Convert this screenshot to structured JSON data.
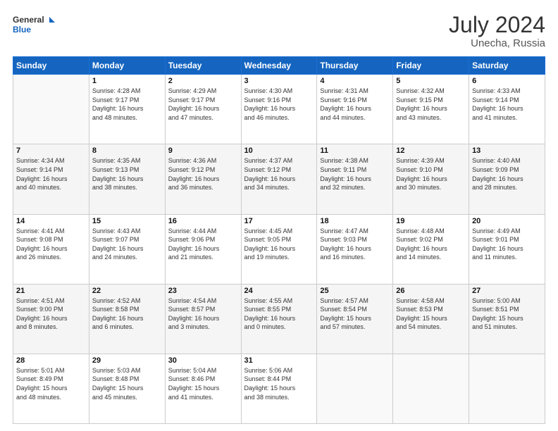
{
  "header": {
    "logo_line1": "General",
    "logo_line2": "Blue",
    "month_year": "July 2024",
    "location": "Unecha, Russia"
  },
  "weekdays": [
    "Sunday",
    "Monday",
    "Tuesday",
    "Wednesday",
    "Thursday",
    "Friday",
    "Saturday"
  ],
  "weeks": [
    [
      {
        "day": "",
        "info": ""
      },
      {
        "day": "1",
        "info": "Sunrise: 4:28 AM\nSunset: 9:17 PM\nDaylight: 16 hours\nand 48 minutes."
      },
      {
        "day": "2",
        "info": "Sunrise: 4:29 AM\nSunset: 9:17 PM\nDaylight: 16 hours\nand 47 minutes."
      },
      {
        "day": "3",
        "info": "Sunrise: 4:30 AM\nSunset: 9:16 PM\nDaylight: 16 hours\nand 46 minutes."
      },
      {
        "day": "4",
        "info": "Sunrise: 4:31 AM\nSunset: 9:16 PM\nDaylight: 16 hours\nand 44 minutes."
      },
      {
        "day": "5",
        "info": "Sunrise: 4:32 AM\nSunset: 9:15 PM\nDaylight: 16 hours\nand 43 minutes."
      },
      {
        "day": "6",
        "info": "Sunrise: 4:33 AM\nSunset: 9:14 PM\nDaylight: 16 hours\nand 41 minutes."
      }
    ],
    [
      {
        "day": "7",
        "info": "Sunrise: 4:34 AM\nSunset: 9:14 PM\nDaylight: 16 hours\nand 40 minutes."
      },
      {
        "day": "8",
        "info": "Sunrise: 4:35 AM\nSunset: 9:13 PM\nDaylight: 16 hours\nand 38 minutes."
      },
      {
        "day": "9",
        "info": "Sunrise: 4:36 AM\nSunset: 9:12 PM\nDaylight: 16 hours\nand 36 minutes."
      },
      {
        "day": "10",
        "info": "Sunrise: 4:37 AM\nSunset: 9:12 PM\nDaylight: 16 hours\nand 34 minutes."
      },
      {
        "day": "11",
        "info": "Sunrise: 4:38 AM\nSunset: 9:11 PM\nDaylight: 16 hours\nand 32 minutes."
      },
      {
        "day": "12",
        "info": "Sunrise: 4:39 AM\nSunset: 9:10 PM\nDaylight: 16 hours\nand 30 minutes."
      },
      {
        "day": "13",
        "info": "Sunrise: 4:40 AM\nSunset: 9:09 PM\nDaylight: 16 hours\nand 28 minutes."
      }
    ],
    [
      {
        "day": "14",
        "info": "Sunrise: 4:41 AM\nSunset: 9:08 PM\nDaylight: 16 hours\nand 26 minutes."
      },
      {
        "day": "15",
        "info": "Sunrise: 4:43 AM\nSunset: 9:07 PM\nDaylight: 16 hours\nand 24 minutes."
      },
      {
        "day": "16",
        "info": "Sunrise: 4:44 AM\nSunset: 9:06 PM\nDaylight: 16 hours\nand 21 minutes."
      },
      {
        "day": "17",
        "info": "Sunrise: 4:45 AM\nSunset: 9:05 PM\nDaylight: 16 hours\nand 19 minutes."
      },
      {
        "day": "18",
        "info": "Sunrise: 4:47 AM\nSunset: 9:03 PM\nDaylight: 16 hours\nand 16 minutes."
      },
      {
        "day": "19",
        "info": "Sunrise: 4:48 AM\nSunset: 9:02 PM\nDaylight: 16 hours\nand 14 minutes."
      },
      {
        "day": "20",
        "info": "Sunrise: 4:49 AM\nSunset: 9:01 PM\nDaylight: 16 hours\nand 11 minutes."
      }
    ],
    [
      {
        "day": "21",
        "info": "Sunrise: 4:51 AM\nSunset: 9:00 PM\nDaylight: 16 hours\nand 8 minutes."
      },
      {
        "day": "22",
        "info": "Sunrise: 4:52 AM\nSunset: 8:58 PM\nDaylight: 16 hours\nand 6 minutes."
      },
      {
        "day": "23",
        "info": "Sunrise: 4:54 AM\nSunset: 8:57 PM\nDaylight: 16 hours\nand 3 minutes."
      },
      {
        "day": "24",
        "info": "Sunrise: 4:55 AM\nSunset: 8:55 PM\nDaylight: 16 hours\nand 0 minutes."
      },
      {
        "day": "25",
        "info": "Sunrise: 4:57 AM\nSunset: 8:54 PM\nDaylight: 15 hours\nand 57 minutes."
      },
      {
        "day": "26",
        "info": "Sunrise: 4:58 AM\nSunset: 8:53 PM\nDaylight: 15 hours\nand 54 minutes."
      },
      {
        "day": "27",
        "info": "Sunrise: 5:00 AM\nSunset: 8:51 PM\nDaylight: 15 hours\nand 51 minutes."
      }
    ],
    [
      {
        "day": "28",
        "info": "Sunrise: 5:01 AM\nSunset: 8:49 PM\nDaylight: 15 hours\nand 48 minutes."
      },
      {
        "day": "29",
        "info": "Sunrise: 5:03 AM\nSunset: 8:48 PM\nDaylight: 15 hours\nand 45 minutes."
      },
      {
        "day": "30",
        "info": "Sunrise: 5:04 AM\nSunset: 8:46 PM\nDaylight: 15 hours\nand 41 minutes."
      },
      {
        "day": "31",
        "info": "Sunrise: 5:06 AM\nSunset: 8:44 PM\nDaylight: 15 hours\nand 38 minutes."
      },
      {
        "day": "",
        "info": ""
      },
      {
        "day": "",
        "info": ""
      },
      {
        "day": "",
        "info": ""
      }
    ]
  ]
}
